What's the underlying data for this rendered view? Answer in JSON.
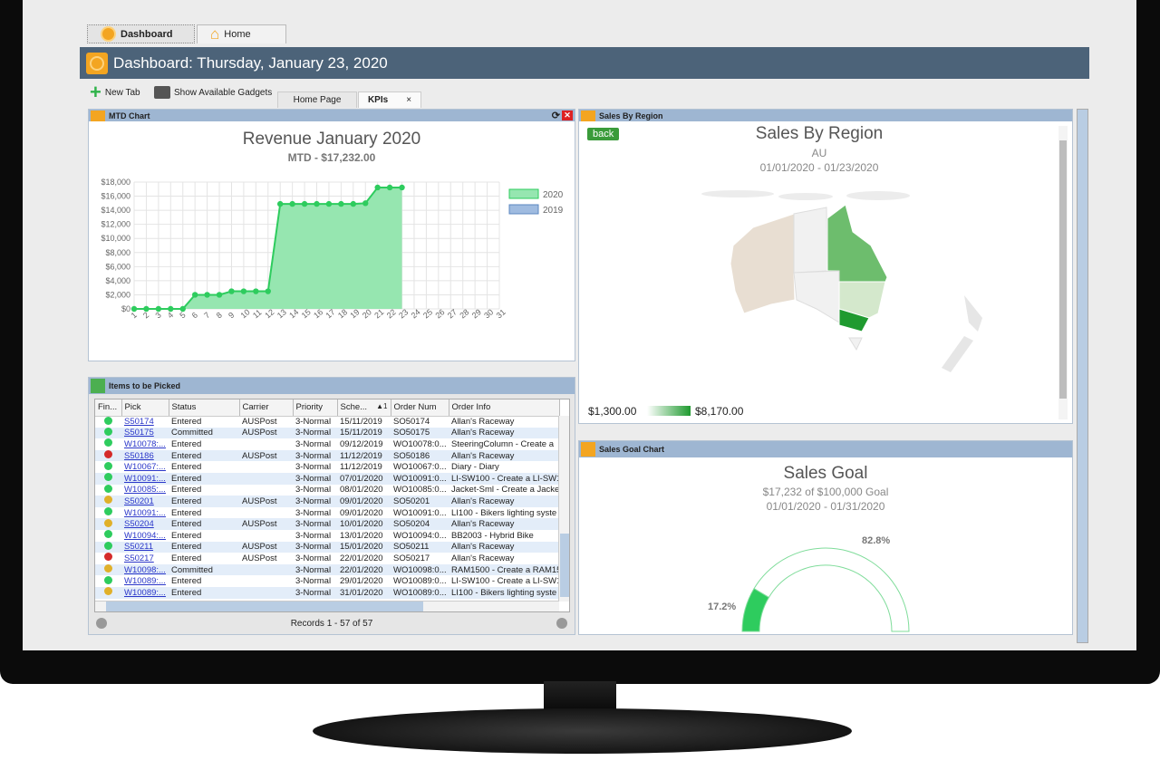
{
  "top_tabs": [
    {
      "label": "Dashboard",
      "icon": "dashboard-gauge-icon"
    },
    {
      "label": "Home",
      "icon": "home-icon"
    }
  ],
  "header": {
    "title": "Dashboard: Thursday, January 23, 2020"
  },
  "toolbar": {
    "new_tab": "New Tab",
    "show_gadgets": "Show Available Gadgets"
  },
  "page_tabs": [
    {
      "label": "Home Page"
    },
    {
      "label": "KPIs",
      "active": true,
      "close": "×"
    }
  ],
  "mtd": {
    "panel_title": "MTD Chart",
    "title": "Revenue January 2020",
    "subtitle": "MTD - $17,232.00"
  },
  "chart_data": {
    "type": "area",
    "title": "Revenue January 2020",
    "subtitle": "MTD - $17,232.00",
    "x": [
      1,
      2,
      3,
      4,
      5,
      6,
      7,
      8,
      9,
      10,
      11,
      12,
      13,
      14,
      15,
      16,
      17,
      18,
      19,
      20,
      21,
      22,
      23,
      24,
      25,
      26,
      27,
      28,
      29,
      30,
      31
    ],
    "ylim": [
      0,
      18000
    ],
    "yticks": [
      "$0",
      "$2,000",
      "$4,000",
      "$6,000",
      "$8,000",
      "$10,000",
      "$12,000",
      "$14,000",
      "$16,000",
      "$18,000"
    ],
    "grid": true,
    "legend": "right",
    "series": [
      {
        "name": "2020",
        "color": "#2ecc5e",
        "values": [
          0,
          0,
          0,
          0,
          0,
          2000,
          2000,
          2000,
          2500,
          2500,
          2500,
          2500,
          14900,
          14900,
          14900,
          14900,
          14900,
          14900,
          14900,
          15000,
          17232,
          17232,
          17232
        ]
      },
      {
        "name": "2019",
        "color": "#5b87c0",
        "values": []
      }
    ]
  },
  "picked": {
    "panel_title": "Items to be Picked",
    "columns": [
      "Fin...",
      "Pick",
      "Status",
      "Carrier",
      "Priority",
      "Sche...",
      "Order Num",
      "Order Info"
    ],
    "rows": [
      [
        "green",
        "S50174",
        "Entered",
        "AUSPost",
        "3-Normal",
        "15/11/2019",
        "SO50174",
        "Allan's Raceway"
      ],
      [
        "green",
        "S50175",
        "Committed",
        "AUSPost",
        "3-Normal",
        "15/11/2019",
        "SO50175",
        "Allan's Raceway"
      ],
      [
        "green",
        "W10078:...",
        "Entered",
        "",
        "3-Normal",
        "09/12/2019",
        "WO10078:0...",
        "SteeringColumn - Create a"
      ],
      [
        "red",
        "S50186",
        "Entered",
        "AUSPost",
        "3-Normal",
        "11/12/2019",
        "SO50186",
        "Allan's Raceway"
      ],
      [
        "green",
        "W10067:...",
        "Entered",
        "",
        "3-Normal",
        "11/12/2019",
        "WO10067:0...",
        "Diary - Diary"
      ],
      [
        "green",
        "W10091:...",
        "Entered",
        "",
        "3-Normal",
        "07/01/2020",
        "WO10091:0...",
        "LI-SW100 - Create a LI-SW1"
      ],
      [
        "green",
        "W10085:...",
        "Entered",
        "",
        "3-Normal",
        "08/01/2020",
        "WO10085:0...",
        "Jacket-Sml - Create a Jacke"
      ],
      [
        "yellow",
        "S50201",
        "Entered",
        "AUSPost",
        "3-Normal",
        "09/01/2020",
        "SO50201",
        "Allan's Raceway"
      ],
      [
        "green",
        "W10091:...",
        "Entered",
        "",
        "3-Normal",
        "09/01/2020",
        "WO10091:0...",
        "LI100 - Bikers lighting syste"
      ],
      [
        "yellow",
        "S50204",
        "Entered",
        "AUSPost",
        "3-Normal",
        "10/01/2020",
        "SO50204",
        "Allan's Raceway"
      ],
      [
        "green",
        "W10094:...",
        "Entered",
        "",
        "3-Normal",
        "13/01/2020",
        "WO10094:0...",
        "BB2003 - Hybrid Bike"
      ],
      [
        "green",
        "S50211",
        "Entered",
        "AUSPost",
        "3-Normal",
        "15/01/2020",
        "SO50211",
        "Allan's Raceway"
      ],
      [
        "red",
        "S50217",
        "Entered",
        "AUSPost",
        "3-Normal",
        "22/01/2020",
        "SO50217",
        "Allan's Raceway"
      ],
      [
        "yellow",
        "W10098:...",
        "Committed",
        "",
        "3-Normal",
        "22/01/2020",
        "WO10098:0...",
        "RAM1500 - Create a RAM15"
      ],
      [
        "green",
        "W10089:...",
        "Entered",
        "",
        "3-Normal",
        "29/01/2020",
        "WO10089:0...",
        "LI-SW100 - Create a LI-SW1"
      ],
      [
        "yellow",
        "W10089:...",
        "Entered",
        "",
        "3-Normal",
        "31/01/2020",
        "WO10089:0...",
        "LI100 - Bikers lighting syste"
      ]
    ],
    "sort_indicator": "1",
    "records": "Records 1 - 57 of 57"
  },
  "status_colors": {
    "green": "#2ecc5e",
    "red": "#d42a2a",
    "yellow": "#e0b02a"
  },
  "region": {
    "panel_title": "Sales By Region",
    "back": "back",
    "title": "Sales By Region",
    "subtitle": "AU",
    "range": "01/01/2020 - 01/23/2020",
    "legend_min": "$1,300.00",
    "legend_max": "$8,170.00"
  },
  "goal": {
    "panel_title": "Sales Goal Chart",
    "title": "Sales Goal",
    "subtitle": "$17,232 of $100,000 Goal",
    "range": "01/01/2020 - 01/31/2020",
    "achieved_pct": 17.2,
    "remaining_pct": 82.8,
    "achieved_label": "17.2%",
    "remaining_label": "82.8%"
  }
}
